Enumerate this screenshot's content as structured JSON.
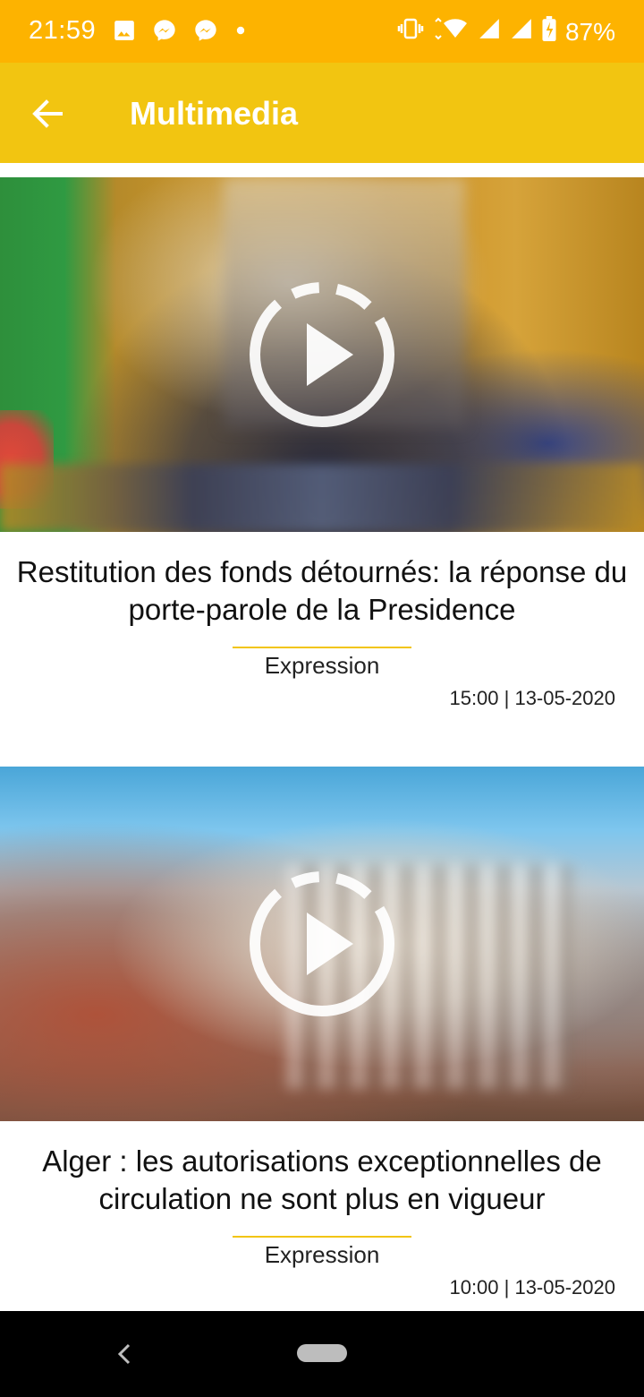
{
  "status_bar": {
    "time": "21:59",
    "battery_percent": "87%",
    "left_icons": [
      "image-icon",
      "messenger-icon",
      "messenger-icon",
      "dot-icon"
    ],
    "right_icons": [
      "vibrate-icon",
      "wifi-icon",
      "signal-icon",
      "signal-icon",
      "battery-charging-icon"
    ]
  },
  "app_bar": {
    "title": "Multimedia",
    "back_icon": "arrow-left-icon"
  },
  "articles": [
    {
      "title": "Restitution des fonds détournés: la réponse du porte-parole de la Presidence",
      "source": "Expression",
      "meta": "15:00 | 13-05-2020"
    },
    {
      "title": "Alger : les autorisations exceptionnelles de circulation ne sont plus en vigueur",
      "source": "Expression",
      "meta": "10:00 | 13-05-2020"
    }
  ],
  "colors": {
    "status_bar": "#FDB300",
    "app_bar": "#F2C511",
    "accent_divider": "#F2C511"
  }
}
